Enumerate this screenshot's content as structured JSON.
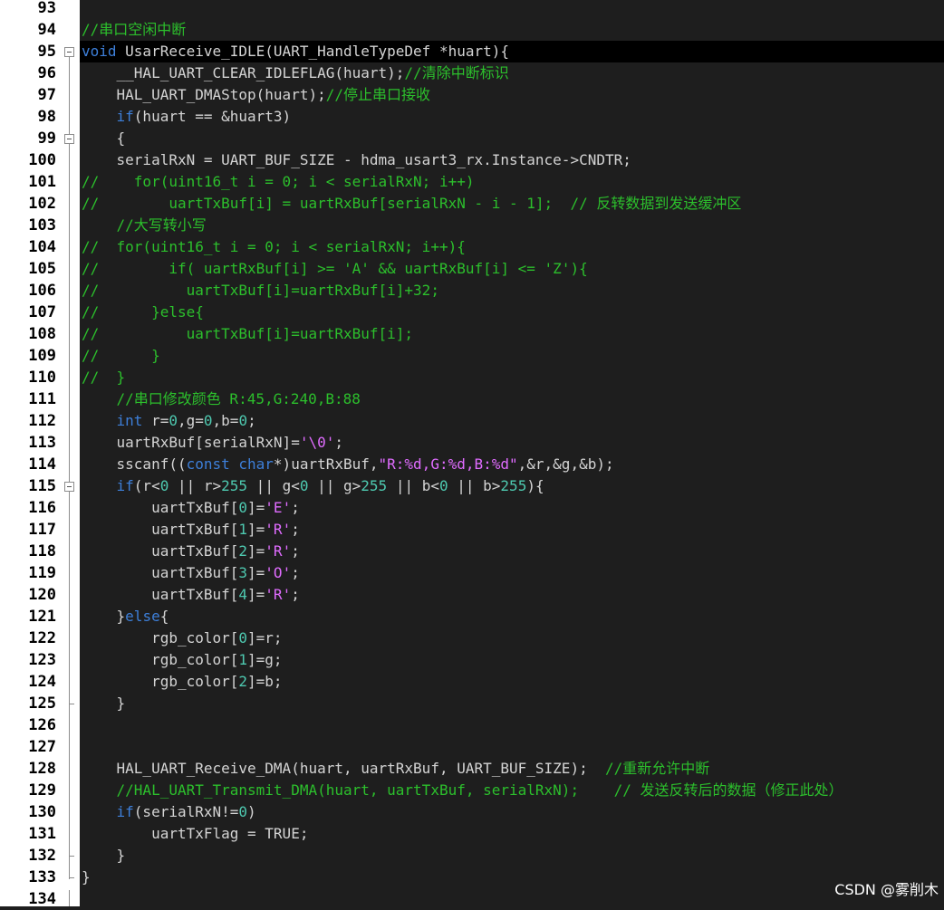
{
  "editor": {
    "active_line": 95,
    "colors": {
      "background": "#1e1e1e",
      "gutter": "#ffffff",
      "line_number": "#000000",
      "default": "#d4d4d4",
      "comment": "#2cbf2c",
      "keyword": "#3d7fd9",
      "number": "#4ec9b0",
      "string": "#e06cff",
      "active_line_bg": "#000000"
    },
    "lines": [
      {
        "n": "93",
        "segs": []
      },
      {
        "n": "94",
        "segs": [
          [
            "c",
            "//串口空闲中断"
          ]
        ]
      },
      {
        "n": "95",
        "segs": [
          [
            "k",
            "void"
          ],
          [
            "d",
            " UsarReceive_IDLE(UART_HandleTypeDef *huart){"
          ]
        ]
      },
      {
        "n": "96",
        "segs": [
          [
            "d",
            "    __HAL_UART_CLEAR_IDLEFLAG(huart);"
          ],
          [
            "c",
            "//清除中断标识"
          ]
        ]
      },
      {
        "n": "97",
        "segs": [
          [
            "d",
            "    HAL_UART_DMAStop(huart);"
          ],
          [
            "c",
            "//停止串口接收"
          ]
        ]
      },
      {
        "n": "98",
        "segs": [
          [
            "k",
            "    if"
          ],
          [
            "d",
            "(huart == &huart3)"
          ]
        ]
      },
      {
        "n": "99",
        "segs": [
          [
            "d",
            "    {"
          ]
        ]
      },
      {
        "n": "100",
        "segs": [
          [
            "d",
            "    serialRxN = UART_BUF_SIZE - hdma_usart3_rx.Instance->CNDTR;"
          ]
        ]
      },
      {
        "n": "101",
        "segs": [
          [
            "c",
            "//    for(uint16_t i = 0; i < serialRxN; i++)"
          ]
        ]
      },
      {
        "n": "102",
        "segs": [
          [
            "c",
            "//        uartTxBuf[i] = uartRxBuf[serialRxN - i - 1];  // 反转数据到发送缓冲区"
          ]
        ]
      },
      {
        "n": "103",
        "segs": [
          [
            "c",
            "    //大写转小写"
          ]
        ]
      },
      {
        "n": "104",
        "segs": [
          [
            "c",
            "//  for(uint16_t i = 0; i < serialRxN; i++){"
          ]
        ]
      },
      {
        "n": "105",
        "segs": [
          [
            "c",
            "//        if( uartRxBuf[i] >= 'A' && uartRxBuf[i] <= 'Z'){"
          ]
        ]
      },
      {
        "n": "106",
        "segs": [
          [
            "c",
            "//          uartTxBuf[i]=uartRxBuf[i]+32;"
          ]
        ]
      },
      {
        "n": "107",
        "segs": [
          [
            "c",
            "//      }else{"
          ]
        ]
      },
      {
        "n": "108",
        "segs": [
          [
            "c",
            "//          uartTxBuf[i]=uartRxBuf[i];"
          ]
        ]
      },
      {
        "n": "109",
        "segs": [
          [
            "c",
            "//      }"
          ]
        ]
      },
      {
        "n": "110",
        "segs": [
          [
            "c",
            "//  }"
          ]
        ]
      },
      {
        "n": "111",
        "segs": [
          [
            "c",
            "    //串口修改颜色 R:45,G:240,B:88"
          ]
        ]
      },
      {
        "n": "112",
        "segs": [
          [
            "k",
            "    int"
          ],
          [
            "d",
            " r="
          ],
          [
            "n",
            "0"
          ],
          [
            "d",
            ",g="
          ],
          [
            "n",
            "0"
          ],
          [
            "d",
            ",b="
          ],
          [
            "n",
            "0"
          ],
          [
            "d",
            ";"
          ]
        ]
      },
      {
        "n": "113",
        "segs": [
          [
            "d",
            "    uartRxBuf[serialRxN]="
          ],
          [
            "s",
            "'\\0'"
          ],
          [
            "d",
            ";"
          ]
        ]
      },
      {
        "n": "114",
        "segs": [
          [
            "d",
            "    sscanf(("
          ],
          [
            "k",
            "const char"
          ],
          [
            "d",
            "*)uartRxBuf,"
          ],
          [
            "s",
            "\"R:%d,G:%d,B:%d\""
          ],
          [
            "d",
            ",&r,&g,&b);"
          ]
        ]
      },
      {
        "n": "115",
        "segs": [
          [
            "k",
            "    if"
          ],
          [
            "d",
            "(r<"
          ],
          [
            "n",
            "0"
          ],
          [
            "d",
            " || r>"
          ],
          [
            "n",
            "255"
          ],
          [
            "d",
            " || g<"
          ],
          [
            "n",
            "0"
          ],
          [
            "d",
            " || g>"
          ],
          [
            "n",
            "255"
          ],
          [
            "d",
            " || b<"
          ],
          [
            "n",
            "0"
          ],
          [
            "d",
            " || b>"
          ],
          [
            "n",
            "255"
          ],
          [
            "d",
            "){"
          ]
        ]
      },
      {
        "n": "116",
        "segs": [
          [
            "d",
            "        uartTxBuf["
          ],
          [
            "n",
            "0"
          ],
          [
            "d",
            "]="
          ],
          [
            "s",
            "'E'"
          ],
          [
            "d",
            ";"
          ]
        ]
      },
      {
        "n": "117",
        "segs": [
          [
            "d",
            "        uartTxBuf["
          ],
          [
            "n",
            "1"
          ],
          [
            "d",
            "]="
          ],
          [
            "s",
            "'R'"
          ],
          [
            "d",
            ";"
          ]
        ]
      },
      {
        "n": "118",
        "segs": [
          [
            "d",
            "        uartTxBuf["
          ],
          [
            "n",
            "2"
          ],
          [
            "d",
            "]="
          ],
          [
            "s",
            "'R'"
          ],
          [
            "d",
            ";"
          ]
        ]
      },
      {
        "n": "119",
        "segs": [
          [
            "d",
            "        uartTxBuf["
          ],
          [
            "n",
            "3"
          ],
          [
            "d",
            "]="
          ],
          [
            "s",
            "'O'"
          ],
          [
            "d",
            ";"
          ]
        ]
      },
      {
        "n": "120",
        "segs": [
          [
            "d",
            "        uartTxBuf["
          ],
          [
            "n",
            "4"
          ],
          [
            "d",
            "]="
          ],
          [
            "s",
            "'R'"
          ],
          [
            "d",
            ";"
          ]
        ]
      },
      {
        "n": "121",
        "segs": [
          [
            "d",
            "    }"
          ],
          [
            "k",
            "else"
          ],
          [
            "d",
            "{"
          ]
        ]
      },
      {
        "n": "122",
        "segs": [
          [
            "d",
            "        rgb_color["
          ],
          [
            "n",
            "0"
          ],
          [
            "d",
            "]=r;"
          ]
        ]
      },
      {
        "n": "123",
        "segs": [
          [
            "d",
            "        rgb_color["
          ],
          [
            "n",
            "1"
          ],
          [
            "d",
            "]=g;"
          ]
        ]
      },
      {
        "n": "124",
        "segs": [
          [
            "d",
            "        rgb_color["
          ],
          [
            "n",
            "2"
          ],
          [
            "d",
            "]=b;"
          ]
        ]
      },
      {
        "n": "125",
        "segs": [
          [
            "d",
            "    }"
          ]
        ]
      },
      {
        "n": "126",
        "segs": []
      },
      {
        "n": "127",
        "segs": []
      },
      {
        "n": "128",
        "segs": [
          [
            "d",
            "    HAL_UART_Receive_DMA(huart, uartRxBuf, UART_BUF_SIZE);  "
          ],
          [
            "c",
            "//重新允许中断"
          ]
        ]
      },
      {
        "n": "129",
        "segs": [
          [
            "c",
            "    //HAL_UART_Transmit_DMA(huart, uartTxBuf, serialRxN);    // 发送反转后的数据（修正此处）"
          ]
        ]
      },
      {
        "n": "130",
        "segs": [
          [
            "k",
            "    if"
          ],
          [
            "d",
            "(serialRxN!="
          ],
          [
            "n",
            "0"
          ],
          [
            "d",
            ")"
          ]
        ]
      },
      {
        "n": "131",
        "segs": [
          [
            "d",
            "        uartTxFlag = TRUE;"
          ]
        ]
      },
      {
        "n": "132",
        "segs": [
          [
            "d",
            "    }"
          ]
        ]
      },
      {
        "n": "133",
        "segs": [
          [
            "d",
            "}"
          ]
        ]
      },
      {
        "n": "134",
        "segs": []
      }
    ],
    "fold_markers": [
      95,
      99,
      115
    ]
  },
  "watermark": "CSDN @雾削木"
}
